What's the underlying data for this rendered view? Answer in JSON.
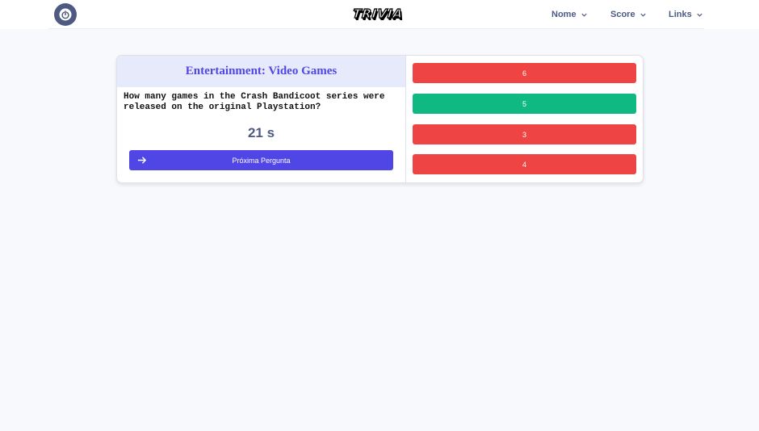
{
  "header": {
    "logo_text": "TRIVIA",
    "menus": [
      {
        "label": "Nome"
      },
      {
        "label": "Score"
      },
      {
        "label": "Links"
      }
    ]
  },
  "question_card": {
    "category": "Entertainment: Video Games",
    "question": "How many games in the Crash Bandicoot series were released on the original Playstation?",
    "timer": "21 s",
    "next_button_label": "Próxima Pergunta",
    "answers": [
      {
        "label": "6",
        "state": "wrong"
      },
      {
        "label": "5",
        "state": "correct"
      },
      {
        "label": "3",
        "state": "wrong"
      },
      {
        "label": "4",
        "state": "wrong"
      }
    ]
  },
  "colors": {
    "accent": "#4f46e5",
    "correct": "#10b981",
    "wrong": "#ef4444",
    "nav_text": "#4b5b85"
  },
  "icons": {
    "power": "power-icon",
    "chevron": "chevron-down-icon",
    "arrow": "arrow-right-icon"
  }
}
